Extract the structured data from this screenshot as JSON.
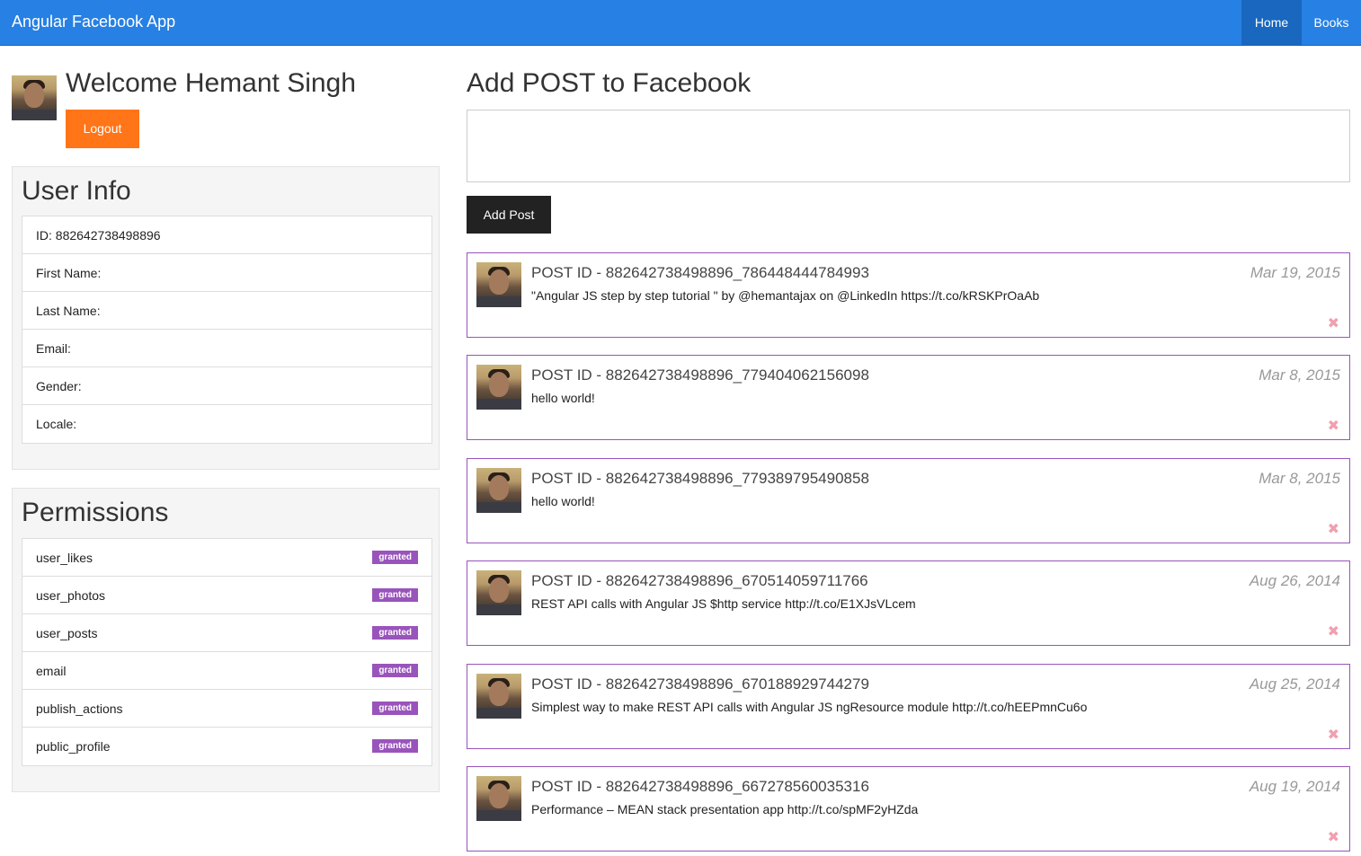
{
  "navbar": {
    "brand": "Angular Facebook App",
    "links": [
      {
        "label": "Home",
        "active": true
      },
      {
        "label": "Books",
        "active": false
      }
    ],
    "color": "#2780e3"
  },
  "welcome": {
    "title": "Welcome Hemant Singh",
    "logout_label": "Logout"
  },
  "user_info": {
    "title": "User Info",
    "fields": [
      "ID: 882642738498896",
      "First Name:",
      "Last Name:",
      "Email:",
      "Gender:",
      "Locale:"
    ]
  },
  "permissions": {
    "title": "Permissions",
    "items": [
      {
        "name": "user_likes",
        "status": "granted"
      },
      {
        "name": "user_photos",
        "status": "granted"
      },
      {
        "name": "user_posts",
        "status": "granted"
      },
      {
        "name": "email",
        "status": "granted"
      },
      {
        "name": "publish_actions",
        "status": "granted"
      },
      {
        "name": "public_profile",
        "status": "granted"
      }
    ]
  },
  "compose": {
    "title": "Add POST to Facebook",
    "textarea_value": "",
    "button_label": "Add Post"
  },
  "posts": [
    {
      "id": "POST ID - 882642738498896_786448444784993",
      "message": "\"Angular JS step by step tutorial \" by @hemantajax on @LinkedIn https://t.co/kRSKPrOaAb",
      "date": "Mar 19, 2015"
    },
    {
      "id": "POST ID - 882642738498896_779404062156098",
      "message": "hello world!",
      "date": "Mar 8, 2015"
    },
    {
      "id": "POST ID - 882642738498896_779389795490858",
      "message": "hello world!",
      "date": "Mar 8, 2015"
    },
    {
      "id": "POST ID - 882642738498896_670514059711766",
      "message": "REST API calls with Angular JS $http service http://t.co/E1XJsVLcem",
      "date": "Aug 26, 2014"
    },
    {
      "id": "POST ID - 882642738498896_670188929744279",
      "message": "Simplest way to make REST API calls with Angular JS ngResource module http://t.co/hEEPmnCu6o",
      "date": "Aug 25, 2014"
    },
    {
      "id": "POST ID - 882642738498896_667278560035316",
      "message": "Performance – MEAN stack presentation app http://t.co/spMF2yHZda",
      "date": "Aug 19, 2014"
    }
  ],
  "delete_icon": "✖",
  "colors": {
    "accent": "#2780e3",
    "logout": "#ff7518",
    "badge": "#9954bb",
    "post_border": "#9954bb"
  }
}
